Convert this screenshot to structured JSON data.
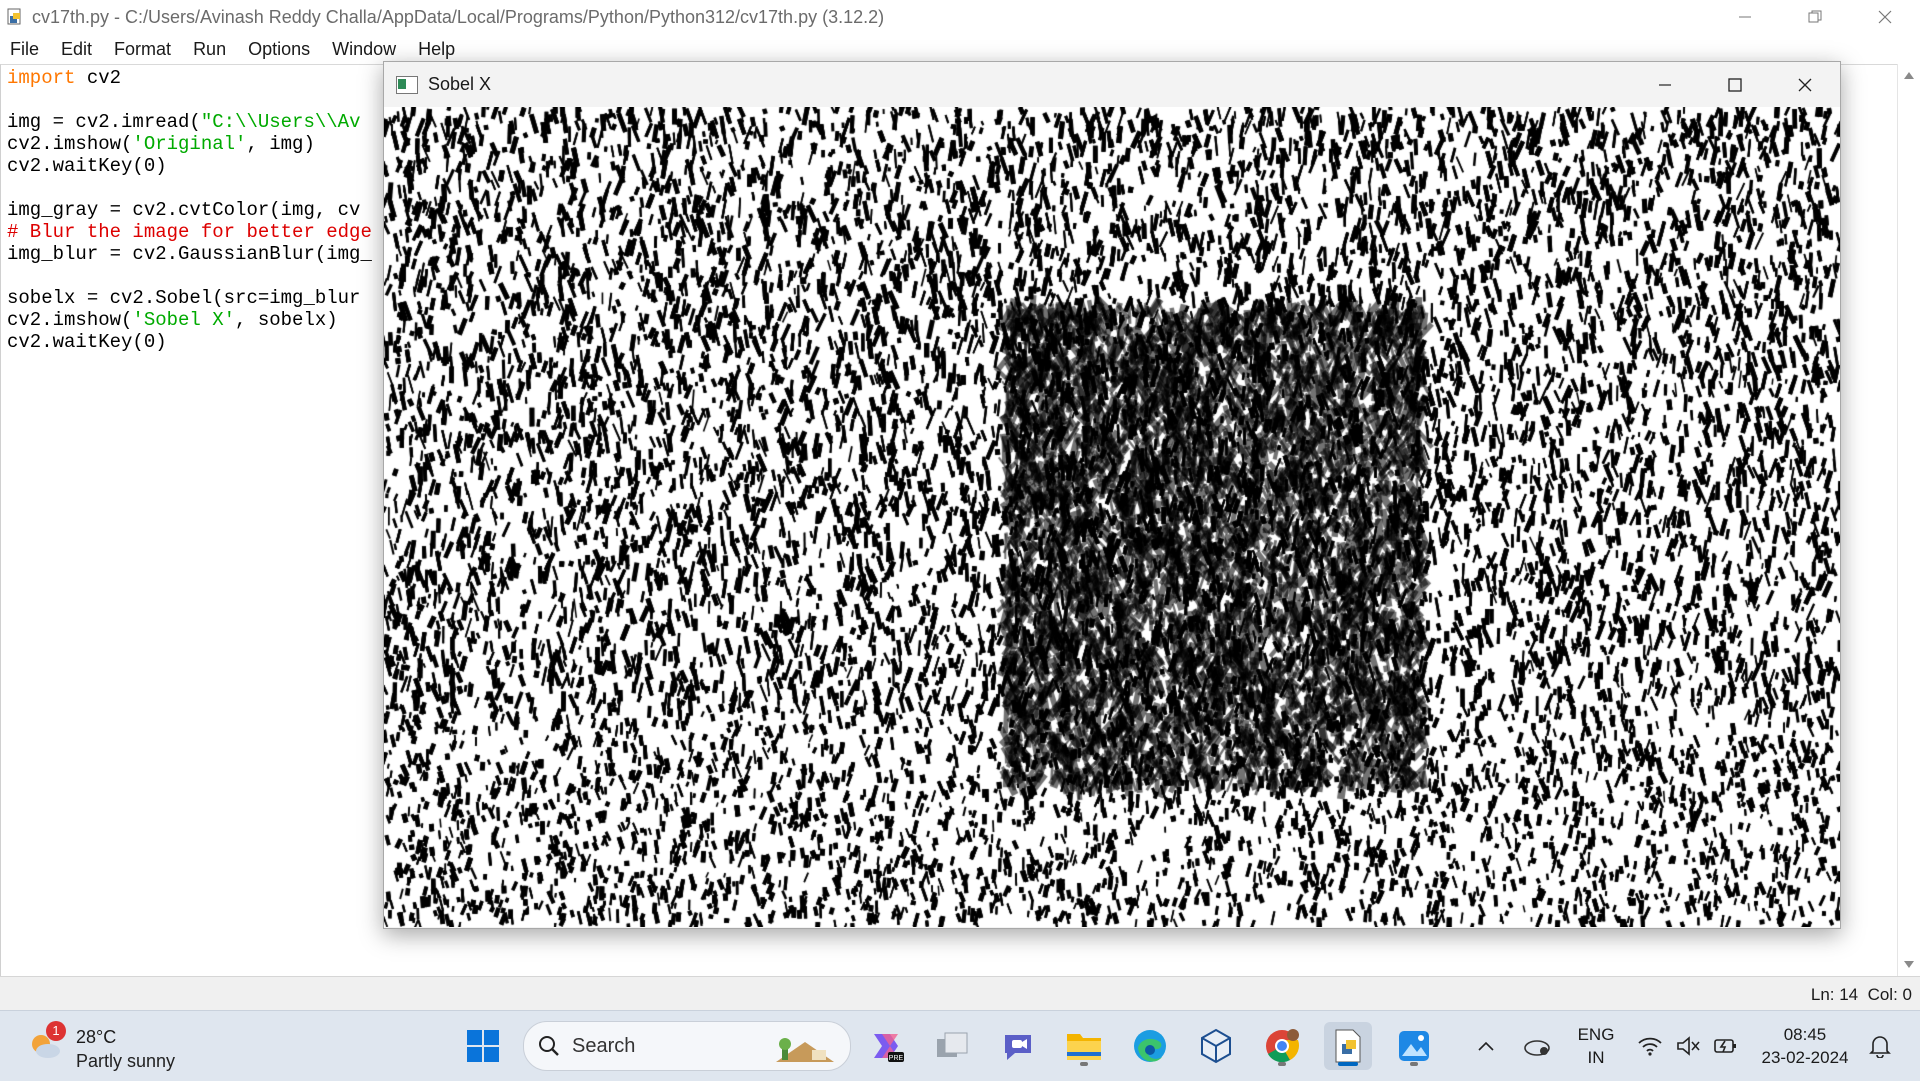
{
  "idle": {
    "title": "cv17th.py - C:/Users/Avinash Reddy Challa/AppData/Local/Programs/Python/Python312/cv17th.py (3.12.2)",
    "menu": [
      "File",
      "Edit",
      "Format",
      "Run",
      "Options",
      "Window",
      "Help"
    ],
    "status": {
      "ln": "Ln: 14",
      "col": "Col: 0"
    }
  },
  "code_lines": [
    [
      {
        "t": "import",
        "c": "kw"
      },
      {
        "t": " cv2",
        "c": ""
      }
    ],
    [],
    [
      {
        "t": "img = cv2.imread(",
        "c": ""
      },
      {
        "t": "\"C:\\\\Users\\\\Av",
        "c": "str"
      }
    ],
    [
      {
        "t": "cv2.imshow(",
        "c": ""
      },
      {
        "t": "'Original'",
        "c": "str"
      },
      {
        "t": ", img)",
        "c": ""
      }
    ],
    [
      {
        "t": "cv2.waitKey(0)",
        "c": ""
      }
    ],
    [],
    [
      {
        "t": "img_gray = cv2.cvtColor(img, cv",
        "c": ""
      }
    ],
    [
      {
        "t": "# Blur the image for better edge",
        "c": "cmt"
      }
    ],
    [
      {
        "t": "img_blur = cv2.GaussianBlur(img_",
        "c": ""
      }
    ],
    [],
    [
      {
        "t": "sobelx = cv2.Sobel(src=img_blur",
        "c": ""
      }
    ],
    [
      {
        "t": "cv2.imshow(",
        "c": ""
      },
      {
        "t": "'Sobel X'",
        "c": "str"
      },
      {
        "t": ", sobelx)",
        "c": ""
      }
    ],
    [
      {
        "t": "cv2.waitKey(0)",
        "c": ""
      }
    ]
  ],
  "sobel_window": {
    "title": "Sobel X"
  },
  "taskbar": {
    "weather": {
      "badge": "1",
      "temp": "28°C",
      "condition": "Partly sunny"
    },
    "search_label": "Search",
    "lang": "ENG",
    "region": "IN",
    "time": "08:45",
    "date": "23-02-2024"
  },
  "colors": {
    "accent": "#0067c0",
    "keyword": "#ff7700",
    "string": "#00aa00",
    "comment": "#dd0000"
  }
}
